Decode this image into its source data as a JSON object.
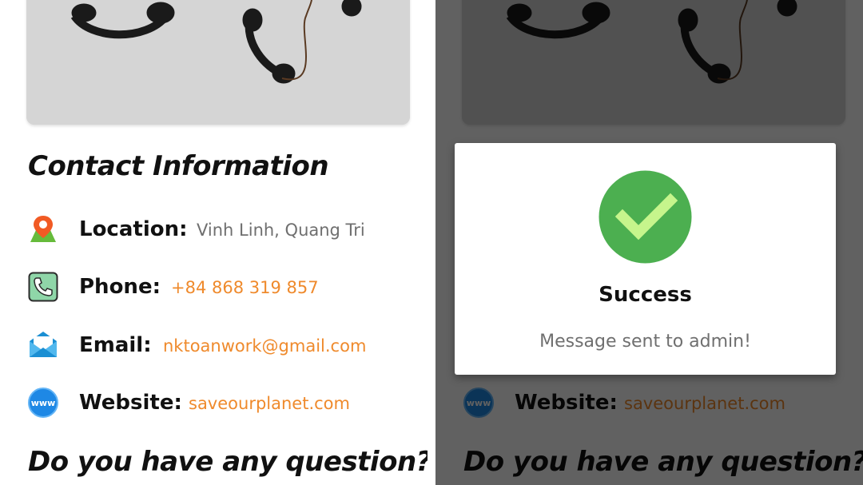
{
  "contact": {
    "title": "Contact Information",
    "items": [
      {
        "label": "Location:",
        "value": "Vinh Linh, Quang Tri",
        "icon": "location-pin-icon"
      },
      {
        "label": "Phone:",
        "value": "+84 868 319 857",
        "icon": "phone-icon"
      },
      {
        "label": "Email:",
        "value": "nktoanwork@gmail.com",
        "icon": "envelope-icon"
      },
      {
        "label": "Website:",
        "value": "saveourplanet.com",
        "icon": "www-globe-icon"
      }
    ]
  },
  "question": {
    "title": "Do you have any question?"
  },
  "dialog": {
    "title": "Success",
    "message": "Message sent to admin!",
    "icon": "check-circle-icon",
    "icon_color": "#4caf50",
    "check_color": "#c6f58c"
  },
  "colors": {
    "link": "#ef8a2c",
    "muted": "#6f6f6f",
    "heading": "#111111",
    "overlay": "rgba(0,0,0,0.62)"
  }
}
